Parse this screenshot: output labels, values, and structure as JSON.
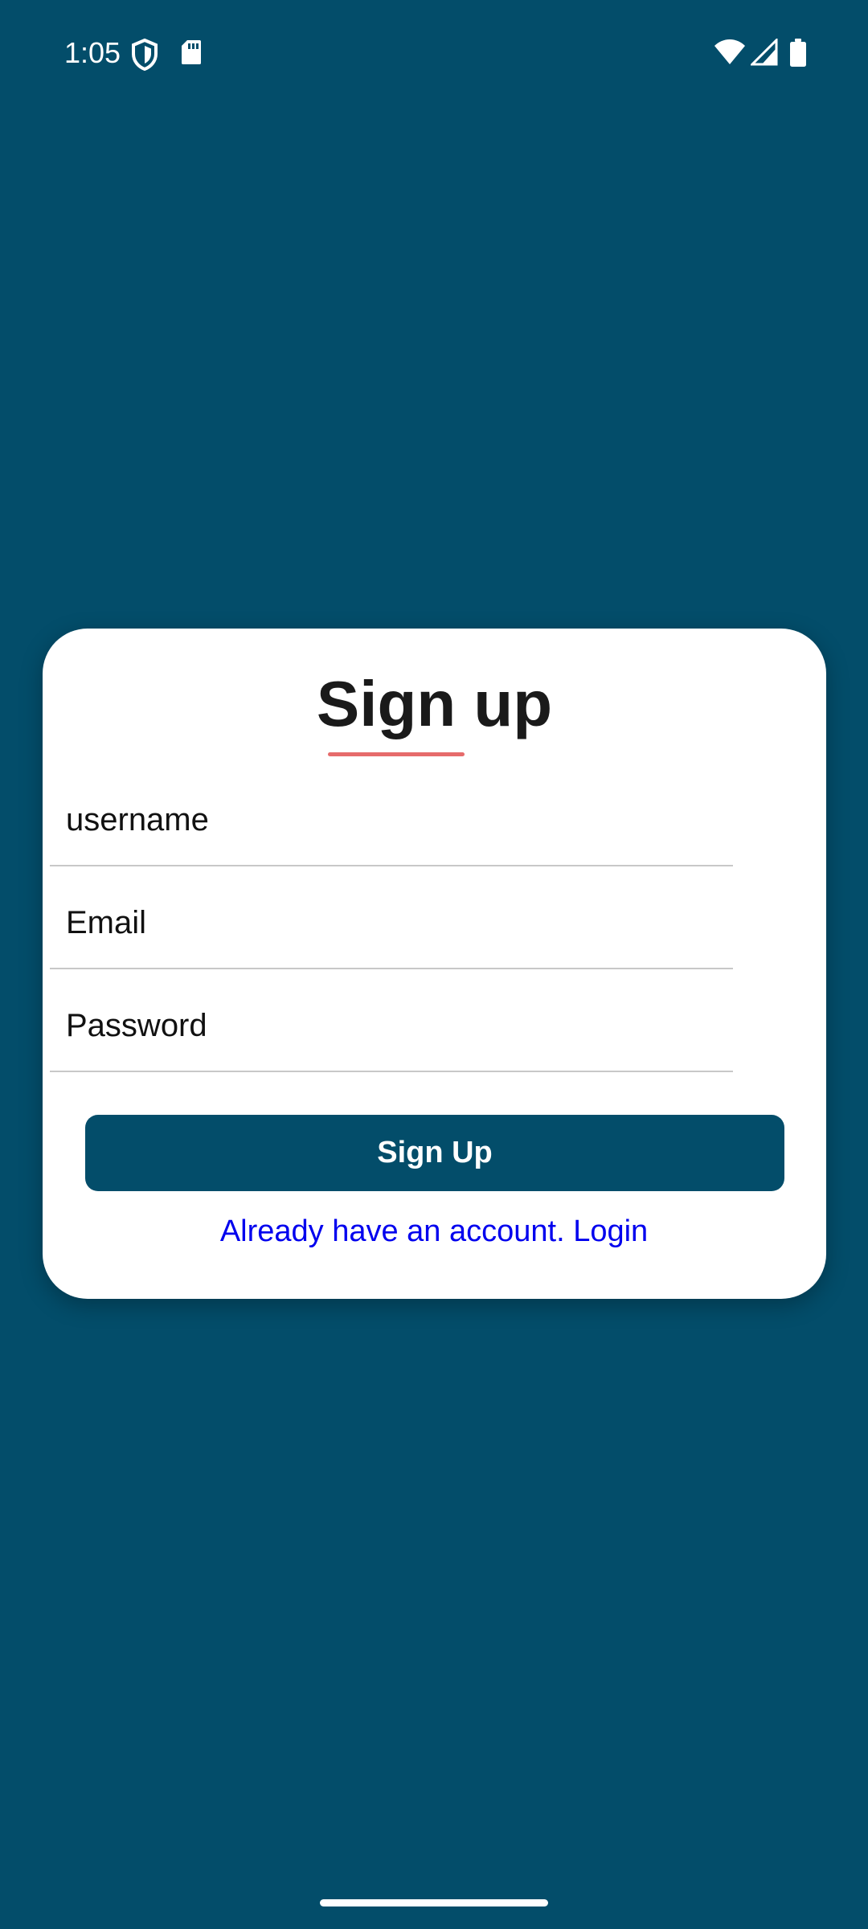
{
  "status_bar": {
    "time": "1:05",
    "icons": [
      "shield-icon",
      "sd-card-icon",
      "wifi-icon",
      "cell-signal-icon",
      "battery-icon"
    ]
  },
  "form": {
    "title": "Sign up",
    "username_placeholder": "username",
    "email_placeholder": "Email",
    "password_placeholder": "Password",
    "submit_label": "Sign Up",
    "login_link": "Already have an account. Login"
  },
  "colors": {
    "background": "#034d6a",
    "card": "#ffffff",
    "button": "#034d6a",
    "title_underline": "#e66b6b",
    "link": "#0000ee"
  }
}
